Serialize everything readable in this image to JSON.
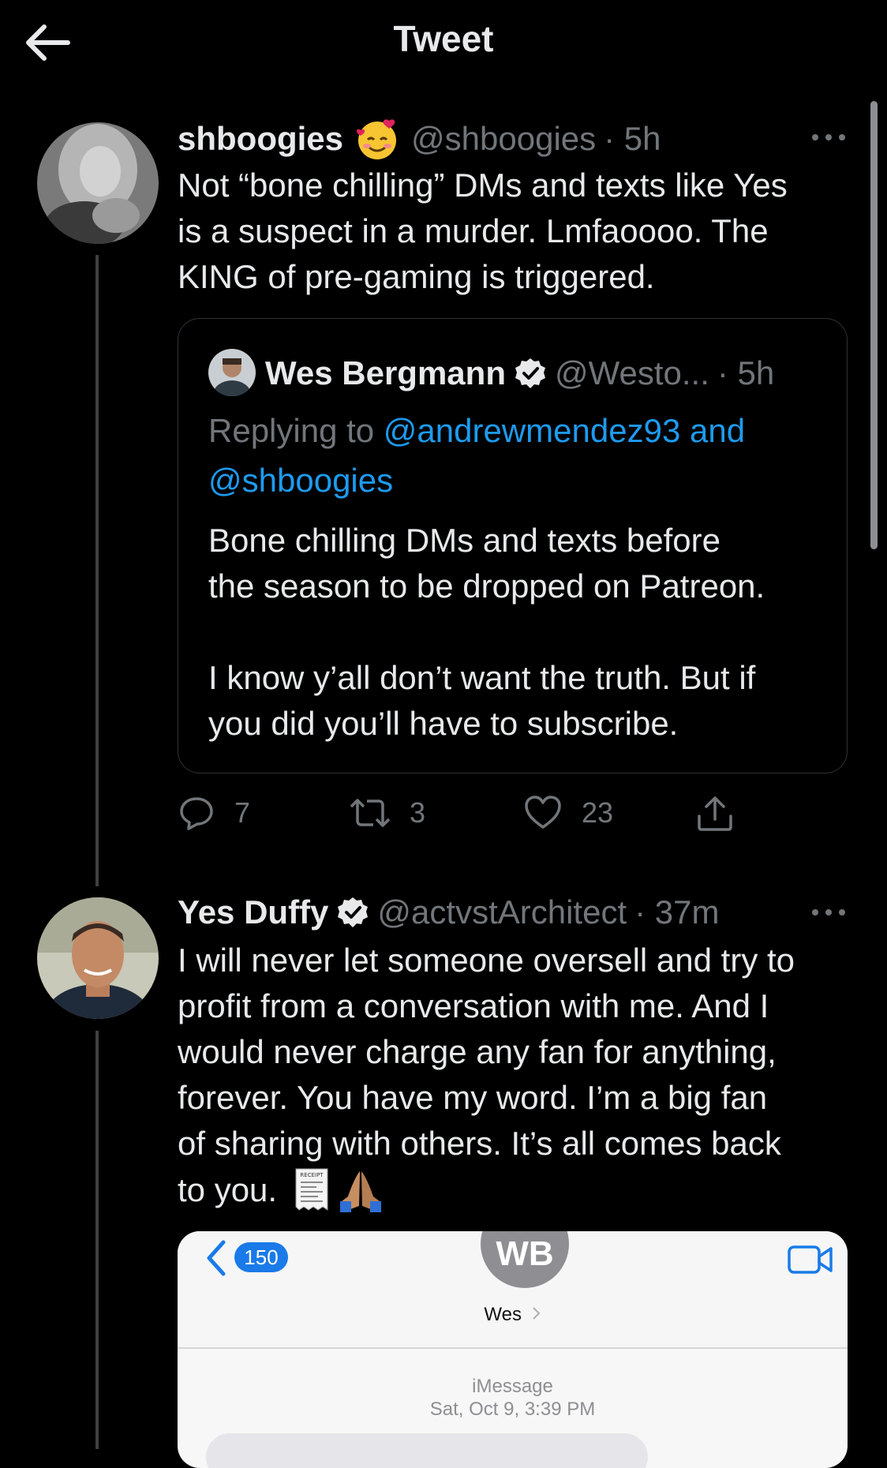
{
  "header": {
    "title": "Tweet"
  },
  "tweet1": {
    "name": "shboogies",
    "handle": "@shboogies",
    "time": "· 5h",
    "lines": [
      "Not “bone chilling” DMs and texts like Yes",
      "is a suspect in a murder. Lmfaoooo. The",
      "KING of pre-gaming is triggered."
    ],
    "emoji": "smiling-face-with-hearts"
  },
  "quote": {
    "name": "Wes Bergmann",
    "handle": "@Westo...",
    "time": "· 5h",
    "replying_prefix": "Replying to",
    "replying_user1": "@andrewmendez93",
    "replying_and": "and",
    "replying_user2": "@shboogies",
    "lines": [
      "Bone chilling DMs and texts before",
      "the season to be dropped on Patreon.",
      "",
      "I know y’all don’t want the truth. But if",
      "you did you’ll have to subscribe."
    ]
  },
  "actions": {
    "replies": "7",
    "retweets": "3",
    "likes": "23"
  },
  "tweet2": {
    "name": "Yes Duffy",
    "handle": "@actvstArchitect",
    "time": "· 37m",
    "lines": [
      "I will never let someone oversell and try to",
      "profit from a conversation with me. And I",
      "would never charge any fan for anything,",
      "forever. You have my word. I’m a big fan",
      "of sharing with others. It’s all comes back",
      "to you."
    ],
    "receipt_label": "RECEIPT"
  },
  "imessage": {
    "badge": "150",
    "initials": "WB",
    "contact": "Wes",
    "service": "iMessage",
    "date": "Sat, Oct 9, 3:39 PM"
  },
  "colors": {
    "accent": "#1d9bf0",
    "text": "#e7e9ea",
    "muted": "#71767b",
    "border": "#2f3336",
    "ios_blue": "#1a7ae8"
  }
}
